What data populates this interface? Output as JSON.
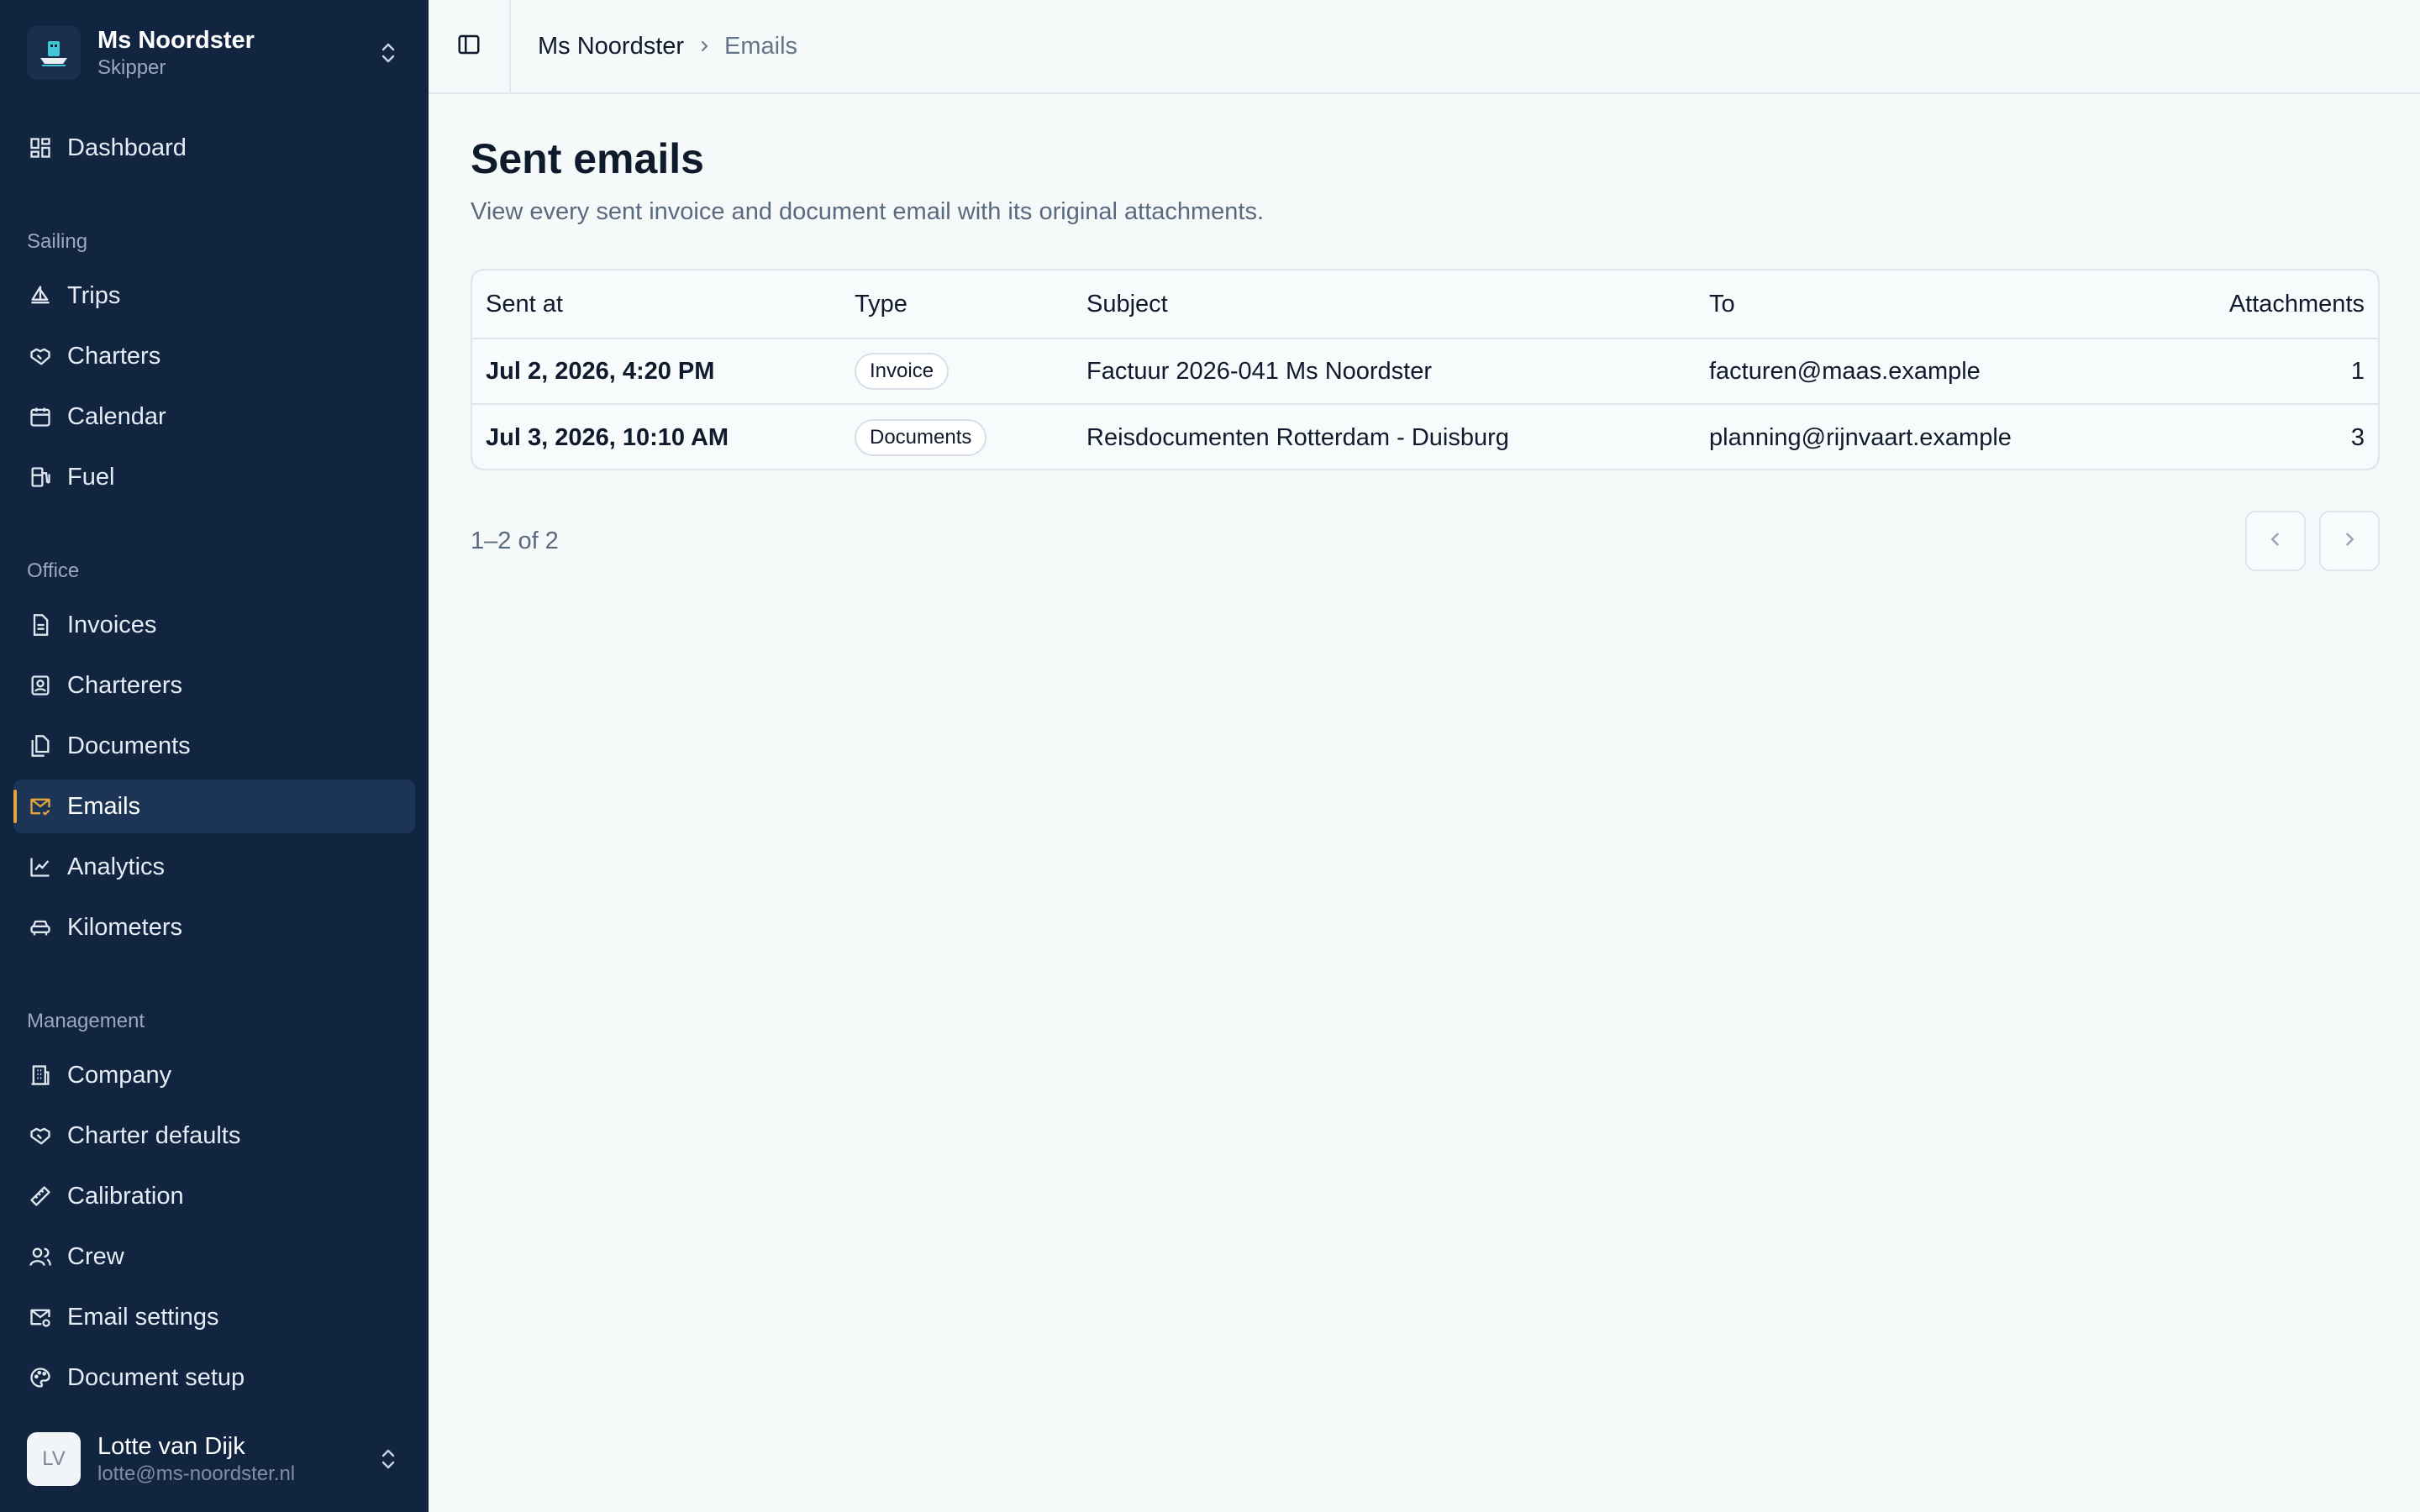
{
  "sidebar": {
    "vessel": {
      "name": "Ms Noordster",
      "role": "Skipper"
    },
    "dashboard": "Dashboard",
    "sections": {
      "sailing": "Sailing",
      "office": "Office",
      "management": "Management"
    },
    "sailing_items": [
      "Trips",
      "Charters",
      "Calendar",
      "Fuel"
    ],
    "office_items": [
      "Invoices",
      "Charterers",
      "Documents",
      "Emails",
      "Analytics",
      "Kilometers"
    ],
    "management_items": [
      "Company",
      "Charter defaults",
      "Calibration",
      "Crew",
      "Email settings",
      "Document setup"
    ],
    "active_item": "Emails",
    "user": {
      "initials": "LV",
      "name": "Lotte van Dijk",
      "email": "lotte@ms-noordster.nl"
    }
  },
  "breadcrumb": {
    "root": "Ms Noordster",
    "current": "Emails"
  },
  "page": {
    "title": "Sent emails",
    "subtitle": "View every sent invoice and document email with its original attachments."
  },
  "table": {
    "headers": {
      "sent_at": "Sent at",
      "type": "Type",
      "subject": "Subject",
      "to": "To",
      "attachments": "Attachments"
    },
    "rows": [
      {
        "sent_at": "Jul 2, 2026, 4:20 PM",
        "type": "Invoice",
        "subject": "Factuur 2026-041 Ms Noordster",
        "to": "facturen@maas.example",
        "attachments": "1"
      },
      {
        "sent_at": "Jul 3, 2026, 10:10 AM",
        "type": "Documents",
        "subject": "Reisdocumenten Rotterdam - Duisburg",
        "to": "planning@rijnvaart.example",
        "attachments": "3"
      }
    ]
  },
  "pagination": {
    "summary": "1–2 of 2"
  },
  "colors": {
    "sidebar_bg": "#112440",
    "active_bg": "#1c3556",
    "accent": "#e8a33d",
    "main_bg": "#f6f9fa"
  }
}
